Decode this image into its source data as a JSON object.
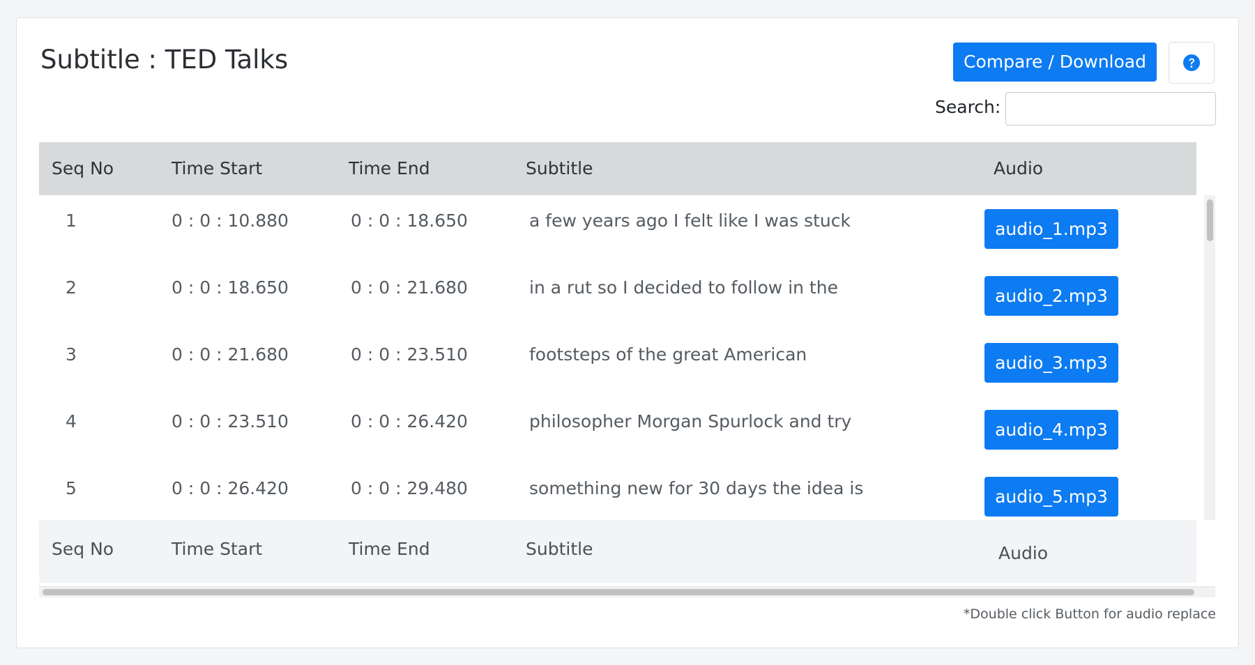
{
  "card": {
    "title": "Subtitle : TED Talks",
    "compare_label": "Compare / Download",
    "help_icon": "question-circle-icon"
  },
  "search": {
    "label": "Search:",
    "value": "",
    "placeholder": ""
  },
  "table": {
    "columns": {
      "seq": "Seq No",
      "start": "Time Start",
      "end": "Time End",
      "subtitle": "Subtitle",
      "audio": "Audio"
    },
    "rows": [
      {
        "seq": "1",
        "start": "0 : 0 : 10.880",
        "end": "0 : 0 : 18.650",
        "subtitle": "a few years ago I felt like I was stuck",
        "audio": "audio_1.mp3"
      },
      {
        "seq": "2",
        "start": "0 : 0 : 18.650",
        "end": "0 : 0 : 21.680",
        "subtitle": "in a rut so I decided to follow in the",
        "audio": "audio_2.mp3"
      },
      {
        "seq": "3",
        "start": "0 : 0 : 21.680",
        "end": "0 : 0 : 23.510",
        "subtitle": "footsteps of the great American",
        "audio": "audio_3.mp3"
      },
      {
        "seq": "4",
        "start": "0 : 0 : 23.510",
        "end": "0 : 0 : 26.420",
        "subtitle": "philosopher Morgan Spurlock and try",
        "audio": "audio_4.mp3"
      },
      {
        "seq": "5",
        "start": "0 : 0 : 26.420",
        "end": "0 : 0 : 29.480",
        "subtitle": "something new for 30 days the idea is",
        "audio": "audio_5.mp3"
      }
    ]
  },
  "note": "*Double click Button for audio replace",
  "colors": {
    "primary": "#0d7bf2",
    "header_bg": "#d8d9da",
    "footer_bg": "#f3f4f6"
  }
}
